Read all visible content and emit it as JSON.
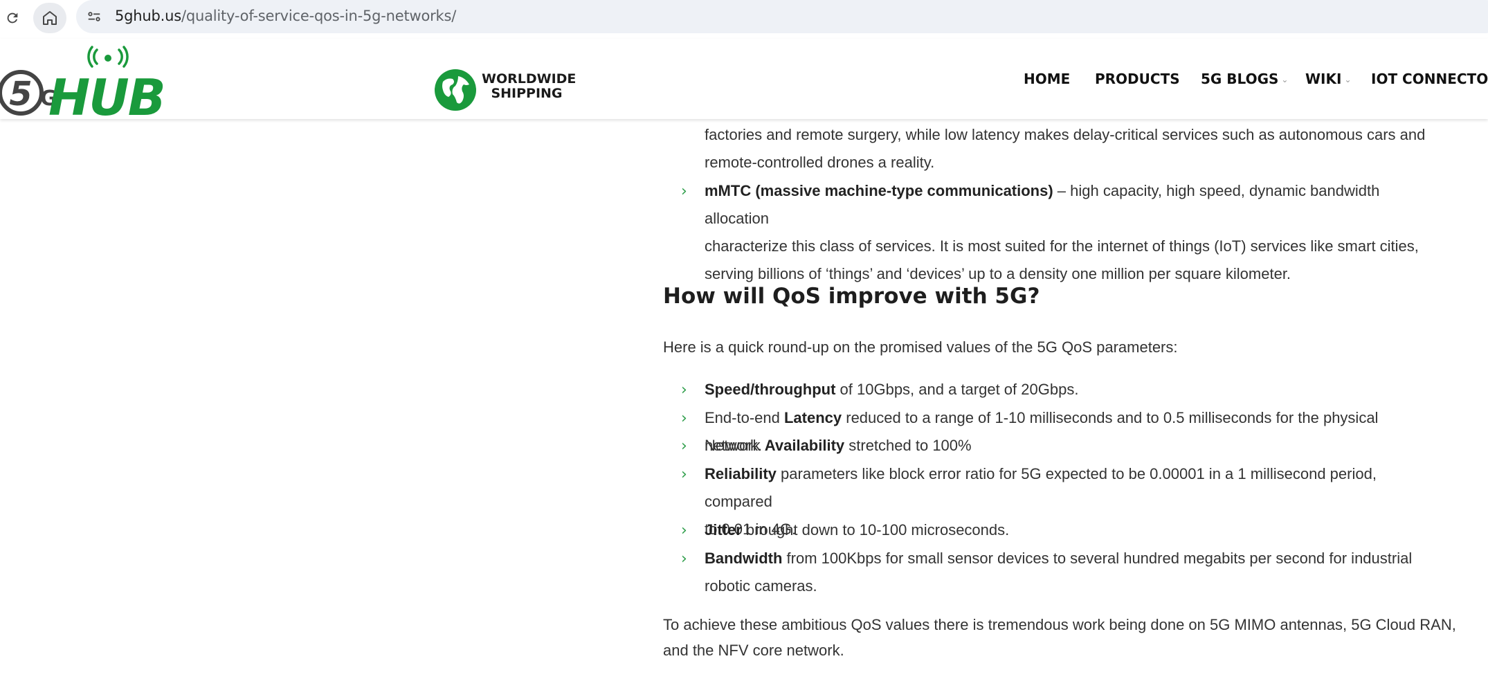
{
  "browser": {
    "url_domain": "5ghub.us",
    "url_path": "/quality-of-service-qos-in-5g-networks/"
  },
  "header": {
    "logo_alt": "5G HUB",
    "shipping_line1": "WORLDWIDE",
    "shipping_line2": "SHIPPING",
    "nav": [
      {
        "label": "HOME",
        "has_dropdown": false
      },
      {
        "label": "PRODUCTS",
        "has_dropdown": false
      },
      {
        "label": "5G BLOGS",
        "has_dropdown": true
      },
      {
        "label": "WIKI",
        "has_dropdown": true
      },
      {
        "label": "IOT CONNECTOR",
        "has_dropdown": false
      }
    ]
  },
  "article": {
    "top_continuation": {
      "line1": "factories and remote surgery, while low latency makes delay-critical services such as autonomous cars and",
      "line2": "remote-controlled drones a reality."
    },
    "mmtc": {
      "bold": "mMTC (massive machine-type communications)",
      "line1_rest": " – high capacity, high speed, dynamic bandwidth allocation",
      "line2": "characterize this class of services. It is most suited for the internet of things (IoT) services like smart cities,",
      "line3": "serving billions of ‘things’ and ‘devices’ up to a density one million per square kilometer."
    },
    "heading": "How will QoS improve with 5G?",
    "intro": "Here is a quick round-up on the promised values of the 5G QoS parameters:",
    "params": [
      {
        "pre": "",
        "bold": "Speed/throughput",
        "post": " of 10Gbps, and a target of 20Gbps."
      },
      {
        "pre": "End-to-end ",
        "bold": "Latency",
        "post": " reduced to a range of 1-10 milliseconds and to 0.5 milliseconds for the physical network."
      },
      {
        "pre": "Network ",
        "bold": "Availability",
        "post": " stretched to 100%"
      },
      {
        "pre": "",
        "bold": "Reliability",
        "post": " parameters like block error ratio for 5G expected to be 0.00001 in a 1 millisecond period, compared",
        "line2": "to 0.01 in 4G."
      },
      {
        "pre": "",
        "bold": "Jitter",
        "post": " brought down to 10-100 microseconds."
      },
      {
        "pre": "",
        "bold": "Bandwidth",
        "post": " from 100Kbps for small sensor devices to several hundred megabits per second for industrial",
        "line2": "robotic cameras."
      }
    ],
    "closing_line1": "To achieve these ambitious QoS values there is tremendous work being done on 5G MIMO antennas, 5G Cloud RAN,",
    "closing_line2": "and the NFV core network."
  },
  "colors": {
    "brand_green": "#1a9a3c",
    "bullet_green": "#2e9e4a",
    "logo_gray": "#444444"
  }
}
